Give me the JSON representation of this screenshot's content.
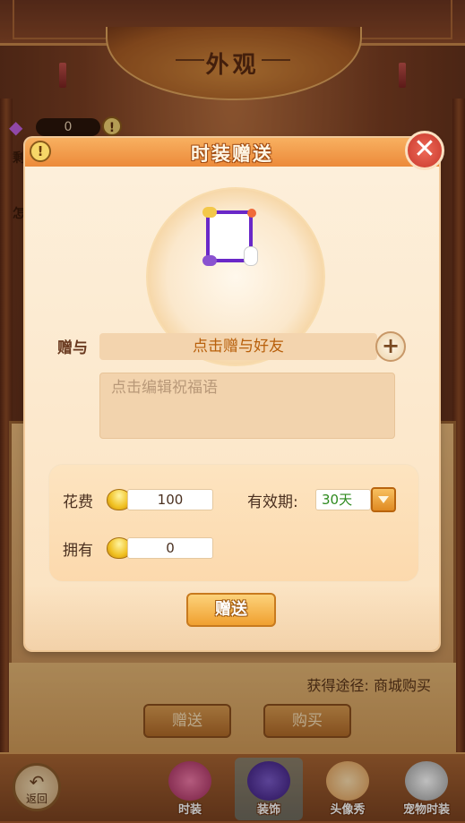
{
  "page": {
    "title": "外观",
    "bg_label_1": "剩",
    "bg_label_2": "怎",
    "gem_count": "0",
    "gem_info_glyph": "!",
    "acquire_source": "获得途径: 商城购买",
    "bg_gift_button": "赠送",
    "bg_buy_button": "购买"
  },
  "bottom_nav": {
    "back_label": "返回",
    "tabs": [
      {
        "label": "时装",
        "icon": "fashion-icon",
        "color": "#d24a7a",
        "active": false
      },
      {
        "label": "装饰",
        "icon": "decoration-icon",
        "color": "#5a3a9a",
        "active": true
      },
      {
        "label": "头像秀",
        "icon": "avatar-show-icon",
        "color": "#f0b070",
        "active": false
      },
      {
        "label": "宠物时装",
        "icon": "pet-fashion-icon",
        "color": "#3a3a3a",
        "active": false
      }
    ]
  },
  "modal": {
    "title": "时装赠送",
    "info_glyph": "!",
    "close_glyph": "✕",
    "gift_to_label": "赠与",
    "friend_placeholder": "点击赠与好友",
    "add_friend_glyph": "+",
    "blessing_placeholder": "点击编辑祝福语",
    "cost_label": "花费",
    "cost_value": "100",
    "validity_label": "有效期:",
    "validity_value": "30天",
    "own_label": "拥有",
    "own_value": "0",
    "send_button": "赠送"
  },
  "colors": {
    "accent": "#ec8a3a",
    "frame_purple": "#6a28c8",
    "validity_green": "#2e8a1e"
  }
}
